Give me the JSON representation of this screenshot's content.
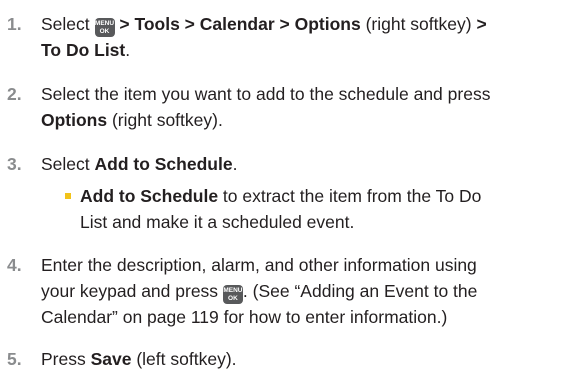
{
  "icon": {
    "line1": "MENU",
    "line2": "OK",
    "color": "#58595b"
  },
  "accent_color": "#f2c31a",
  "step1": {
    "num": "1.",
    "a": "Select ",
    "b": " > Tools > Calendar > Options",
    "c": " (right softkey) ",
    "d": ">",
    "e": "To Do List",
    "f": "."
  },
  "step2": {
    "num": "2.",
    "line1": "Select the item you want to add to the schedule and press",
    "b": "Options",
    "c": " (right softkey)."
  },
  "step3": {
    "num": "3.",
    "a": "Select ",
    "b": "Add to Schedule",
    "c": ".",
    "sub": {
      "b": "Add to Schedule",
      "a": " to extract the item from the To Do",
      "line2": "List and make it a scheduled event."
    }
  },
  "step4": {
    "num": "4.",
    "line1": "Enter the description, alarm, and other information using",
    "a": "your keypad and press ",
    "b": ". (See “Adding an Event to the",
    "line3": "Calendar” on page 119 for how to enter information.)"
  },
  "step5": {
    "num": "5.",
    "a": "Press ",
    "b": "Save",
    "c": " (left softkey)."
  }
}
